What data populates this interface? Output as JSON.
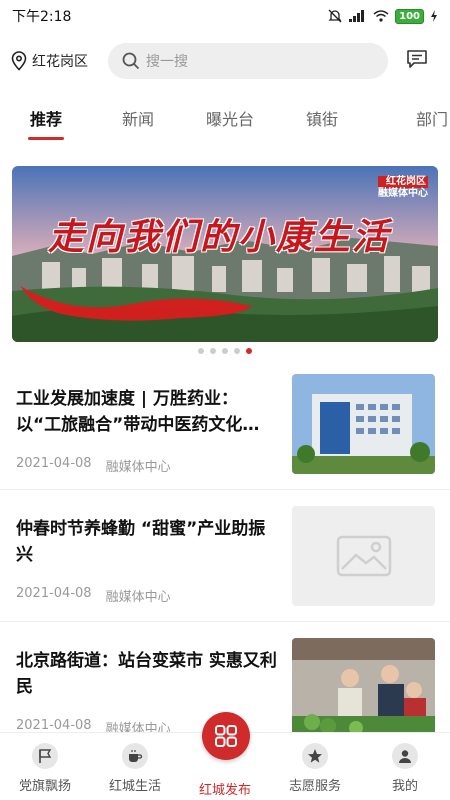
{
  "status_bar": {
    "time": "下午2:18",
    "battery": "100"
  },
  "header": {
    "location": "红花岗区",
    "search_placeholder": "搜一搜"
  },
  "tabs": [
    {
      "label": "推荐",
      "active": true
    },
    {
      "label": "新闻"
    },
    {
      "label": "曝光台"
    },
    {
      "label": "镇街"
    },
    {
      "label": "部门"
    }
  ],
  "banner": {
    "title": "走向我们的小康生活",
    "brand_line1": "红花岗区",
    "brand_line2": "融媒体中心",
    "slide_count": 5,
    "active_slide": 5
  },
  "articles": [
    {
      "title": "工业发展加速度 | 万胜药业：以“工旅融合”带动中医药文化…",
      "date": "2021-04-08",
      "source": "融媒体中心",
      "thumb": "building"
    },
    {
      "title": "仲春时节养蜂勤 “甜蜜”产业助振兴",
      "date": "2021-04-08",
      "source": "融媒体中心",
      "thumb": "placeholder"
    },
    {
      "title": "北京路街道：站台变菜市 实惠又利民",
      "date": "2021-04-08",
      "source": "融媒体中心",
      "thumb": "market"
    }
  ],
  "bottom_nav": [
    {
      "label": "党旗飘扬"
    },
    {
      "label": "红城生活"
    },
    {
      "label": "红城发布",
      "active": true
    },
    {
      "label": "志愿服务"
    },
    {
      "label": "我的"
    }
  ],
  "colors": {
    "accent": "#d12a2a",
    "muted": "#999999"
  }
}
